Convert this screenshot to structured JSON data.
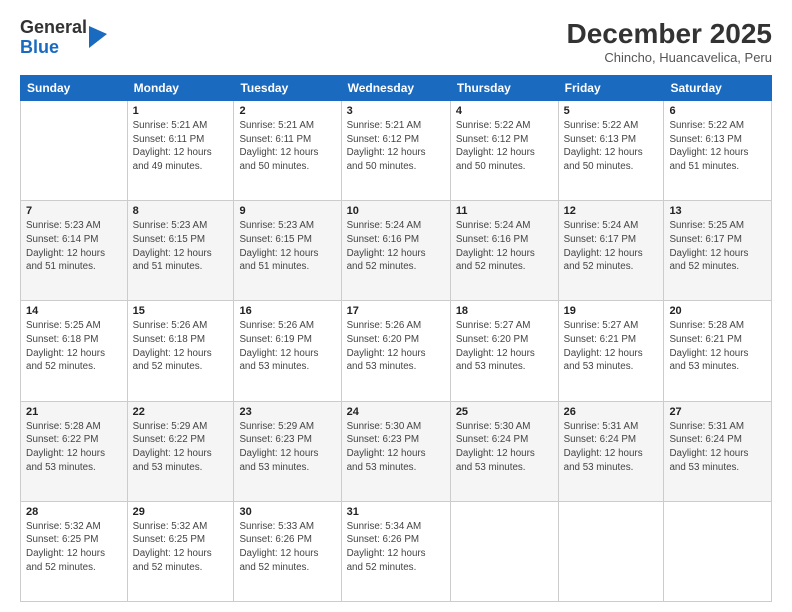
{
  "header": {
    "logo_general": "General",
    "logo_blue": "Blue",
    "month_title": "December 2025",
    "location": "Chincho, Huancavelica, Peru"
  },
  "columns": [
    "Sunday",
    "Monday",
    "Tuesday",
    "Wednesday",
    "Thursday",
    "Friday",
    "Saturday"
  ],
  "weeks": [
    [
      {
        "day": "",
        "info": ""
      },
      {
        "day": "1",
        "info": "Sunrise: 5:21 AM\nSunset: 6:11 PM\nDaylight: 12 hours\nand 49 minutes."
      },
      {
        "day": "2",
        "info": "Sunrise: 5:21 AM\nSunset: 6:11 PM\nDaylight: 12 hours\nand 50 minutes."
      },
      {
        "day": "3",
        "info": "Sunrise: 5:21 AM\nSunset: 6:12 PM\nDaylight: 12 hours\nand 50 minutes."
      },
      {
        "day": "4",
        "info": "Sunrise: 5:22 AM\nSunset: 6:12 PM\nDaylight: 12 hours\nand 50 minutes."
      },
      {
        "day": "5",
        "info": "Sunrise: 5:22 AM\nSunset: 6:13 PM\nDaylight: 12 hours\nand 50 minutes."
      },
      {
        "day": "6",
        "info": "Sunrise: 5:22 AM\nSunset: 6:13 PM\nDaylight: 12 hours\nand 51 minutes."
      }
    ],
    [
      {
        "day": "7",
        "info": "Sunrise: 5:23 AM\nSunset: 6:14 PM\nDaylight: 12 hours\nand 51 minutes."
      },
      {
        "day": "8",
        "info": "Sunrise: 5:23 AM\nSunset: 6:15 PM\nDaylight: 12 hours\nand 51 minutes."
      },
      {
        "day": "9",
        "info": "Sunrise: 5:23 AM\nSunset: 6:15 PM\nDaylight: 12 hours\nand 51 minutes."
      },
      {
        "day": "10",
        "info": "Sunrise: 5:24 AM\nSunset: 6:16 PM\nDaylight: 12 hours\nand 52 minutes."
      },
      {
        "day": "11",
        "info": "Sunrise: 5:24 AM\nSunset: 6:16 PM\nDaylight: 12 hours\nand 52 minutes."
      },
      {
        "day": "12",
        "info": "Sunrise: 5:24 AM\nSunset: 6:17 PM\nDaylight: 12 hours\nand 52 minutes."
      },
      {
        "day": "13",
        "info": "Sunrise: 5:25 AM\nSunset: 6:17 PM\nDaylight: 12 hours\nand 52 minutes."
      }
    ],
    [
      {
        "day": "14",
        "info": "Sunrise: 5:25 AM\nSunset: 6:18 PM\nDaylight: 12 hours\nand 52 minutes."
      },
      {
        "day": "15",
        "info": "Sunrise: 5:26 AM\nSunset: 6:18 PM\nDaylight: 12 hours\nand 52 minutes."
      },
      {
        "day": "16",
        "info": "Sunrise: 5:26 AM\nSunset: 6:19 PM\nDaylight: 12 hours\nand 53 minutes."
      },
      {
        "day": "17",
        "info": "Sunrise: 5:26 AM\nSunset: 6:20 PM\nDaylight: 12 hours\nand 53 minutes."
      },
      {
        "day": "18",
        "info": "Sunrise: 5:27 AM\nSunset: 6:20 PM\nDaylight: 12 hours\nand 53 minutes."
      },
      {
        "day": "19",
        "info": "Sunrise: 5:27 AM\nSunset: 6:21 PM\nDaylight: 12 hours\nand 53 minutes."
      },
      {
        "day": "20",
        "info": "Sunrise: 5:28 AM\nSunset: 6:21 PM\nDaylight: 12 hours\nand 53 minutes."
      }
    ],
    [
      {
        "day": "21",
        "info": "Sunrise: 5:28 AM\nSunset: 6:22 PM\nDaylight: 12 hours\nand 53 minutes."
      },
      {
        "day": "22",
        "info": "Sunrise: 5:29 AM\nSunset: 6:22 PM\nDaylight: 12 hours\nand 53 minutes."
      },
      {
        "day": "23",
        "info": "Sunrise: 5:29 AM\nSunset: 6:23 PM\nDaylight: 12 hours\nand 53 minutes."
      },
      {
        "day": "24",
        "info": "Sunrise: 5:30 AM\nSunset: 6:23 PM\nDaylight: 12 hours\nand 53 minutes."
      },
      {
        "day": "25",
        "info": "Sunrise: 5:30 AM\nSunset: 6:24 PM\nDaylight: 12 hours\nand 53 minutes."
      },
      {
        "day": "26",
        "info": "Sunrise: 5:31 AM\nSunset: 6:24 PM\nDaylight: 12 hours\nand 53 minutes."
      },
      {
        "day": "27",
        "info": "Sunrise: 5:31 AM\nSunset: 6:24 PM\nDaylight: 12 hours\nand 53 minutes."
      }
    ],
    [
      {
        "day": "28",
        "info": "Sunrise: 5:32 AM\nSunset: 6:25 PM\nDaylight: 12 hours\nand 52 minutes."
      },
      {
        "day": "29",
        "info": "Sunrise: 5:32 AM\nSunset: 6:25 PM\nDaylight: 12 hours\nand 52 minutes."
      },
      {
        "day": "30",
        "info": "Sunrise: 5:33 AM\nSunset: 6:26 PM\nDaylight: 12 hours\nand 52 minutes."
      },
      {
        "day": "31",
        "info": "Sunrise: 5:34 AM\nSunset: 6:26 PM\nDaylight: 12 hours\nand 52 minutes."
      },
      {
        "day": "",
        "info": ""
      },
      {
        "day": "",
        "info": ""
      },
      {
        "day": "",
        "info": ""
      }
    ]
  ]
}
